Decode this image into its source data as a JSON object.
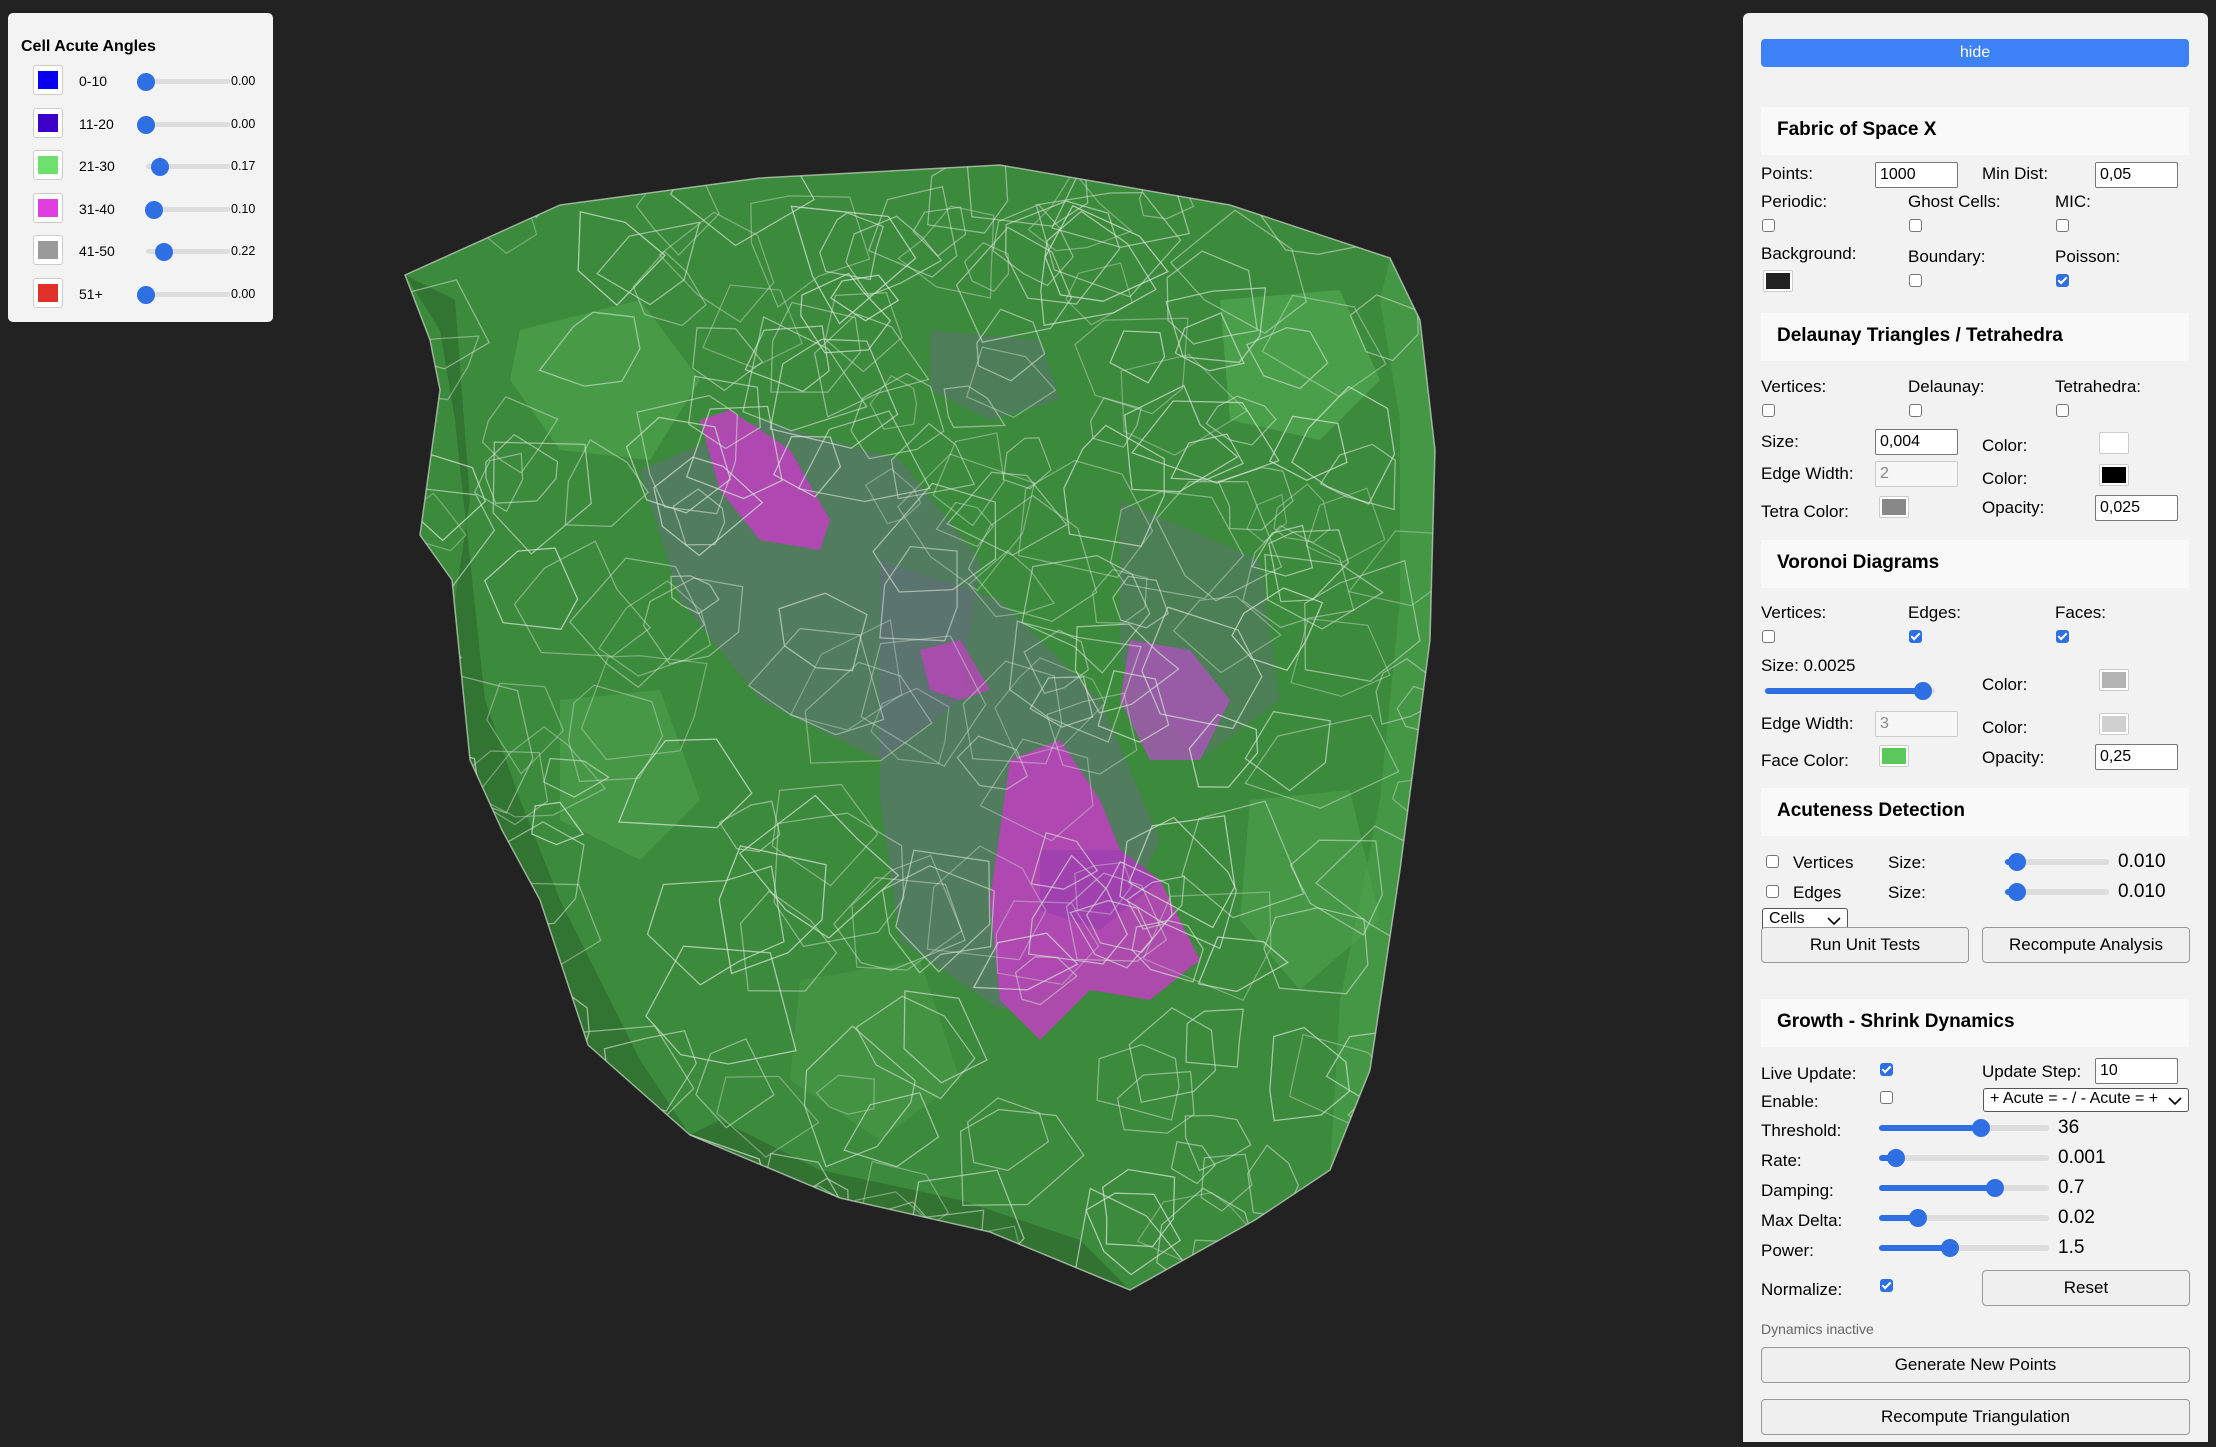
{
  "legend": {
    "title": "Cell Acute Angles",
    "items": [
      {
        "label": "0-10",
        "color": "#0a00f0",
        "value": "0.00",
        "level": 0.0
      },
      {
        "label": "11-20",
        "color": "#3c00c8",
        "value": "0.00",
        "level": 0.0
      },
      {
        "label": "21-30",
        "color": "#6ee06e",
        "value": "0.17",
        "level": 0.17
      },
      {
        "label": "31-40",
        "color": "#e040e0",
        "value": "0.10",
        "level": 0.1
      },
      {
        "label": "41-50",
        "color": "#9a9a9a",
        "value": "0.22",
        "level": 0.22
      },
      {
        "label": "51+",
        "color": "#e0302a",
        "value": "0.00",
        "level": 0.0
      }
    ]
  },
  "panel": {
    "hide_label": "hide",
    "fabric": {
      "title": "Fabric of Space X",
      "points_label": "Points:",
      "points_value": "1000",
      "mindist_label": "Min Dist:",
      "mindist_value": "0,05",
      "periodic_label": "Periodic:",
      "periodic_checked": false,
      "ghost_label": "Ghost Cells:",
      "ghost_checked": false,
      "mic_label": "MIC:",
      "mic_checked": false,
      "background_label": "Background:",
      "background_color": "#222222",
      "boundary_label": "Boundary:",
      "boundary_checked": false,
      "poisson_label": "Poisson:",
      "poisson_checked": true
    },
    "delaunay": {
      "title": "Delaunay Triangles / Tetrahedra",
      "vertices_label": "Vertices:",
      "vertices_checked": false,
      "delaunay_label": "Delaunay:",
      "delaunay_checked": false,
      "tetra_label": "Tetrahedra:",
      "tetra_checked": false,
      "size_label": "Size:",
      "size_value": "0,004",
      "color1_label": "Color:",
      "color1": "#ffffff",
      "edgewidth_label": "Edge Width:",
      "edgewidth_value": "2",
      "color2_label": "Color:",
      "color2": "#000000",
      "tetracolor_label": "Tetra Color:",
      "tetracolor": "#888888",
      "opacity_label": "Opacity:",
      "opacity_value": "0,025"
    },
    "voronoi": {
      "title": "Voronoi Diagrams",
      "vertices_label": "Vertices:",
      "vertices_checked": false,
      "edges_label": "Edges:",
      "edges_checked": true,
      "faces_label": "Faces:",
      "faces_checked": true,
      "size_label": "Size: 0.0025",
      "size_level": 0.93,
      "color1_label": "Color:",
      "color1": "#b4b4b4",
      "edgewidth_label": "Edge Width:",
      "edgewidth_value": "3",
      "color2_label": "Color:",
      "color2": "#d0d0d0",
      "facecolor_label": "Face Color:",
      "facecolor": "#5cc85c",
      "opacity_label": "Opacity:",
      "opacity_value": "0,25"
    },
    "acuteness": {
      "title": "Acuteness Detection",
      "vertices_label": "Vertices",
      "vertices_checked": false,
      "edges_label": "Edges",
      "edges_checked": false,
      "size1_label": "Size:",
      "size1_value": "0.010",
      "size1_level": 0.12,
      "size2_label": "Size:",
      "size2_value": "0.010",
      "size2_level": 0.12,
      "mode_value": "Cells",
      "run_tests_label": "Run Unit Tests",
      "recompute_analysis_label": "Recompute Analysis"
    },
    "growth": {
      "title": "Growth - Shrink Dynamics",
      "live_label": "Live Update:",
      "live_checked": true,
      "step_label": "Update Step:",
      "step_value": "10",
      "enable_label": "Enable:",
      "enable_checked": false,
      "mode_value": "+ Acute = - / - Acute = +",
      "threshold_label": "Threshold:",
      "threshold_value": "36",
      "threshold_level": 0.6,
      "rate_label": "Rate:",
      "rate_value": "0.001",
      "rate_level": 0.1,
      "damping_label": "Damping:",
      "damping_value": "0.7",
      "damping_level": 0.68,
      "maxdelta_label": "Max Delta:",
      "maxdelta_value": "0.02",
      "maxdelta_level": 0.23,
      "power_label": "Power:",
      "power_value": "1.5",
      "power_level": 0.42,
      "normalize_label": "Normalize:",
      "normalize_checked": true,
      "reset_label": "Reset",
      "status": "Dynamics inactive",
      "generate_label": "Generate New Points",
      "recompute_tri_label": "Recompute Triangulation"
    }
  }
}
